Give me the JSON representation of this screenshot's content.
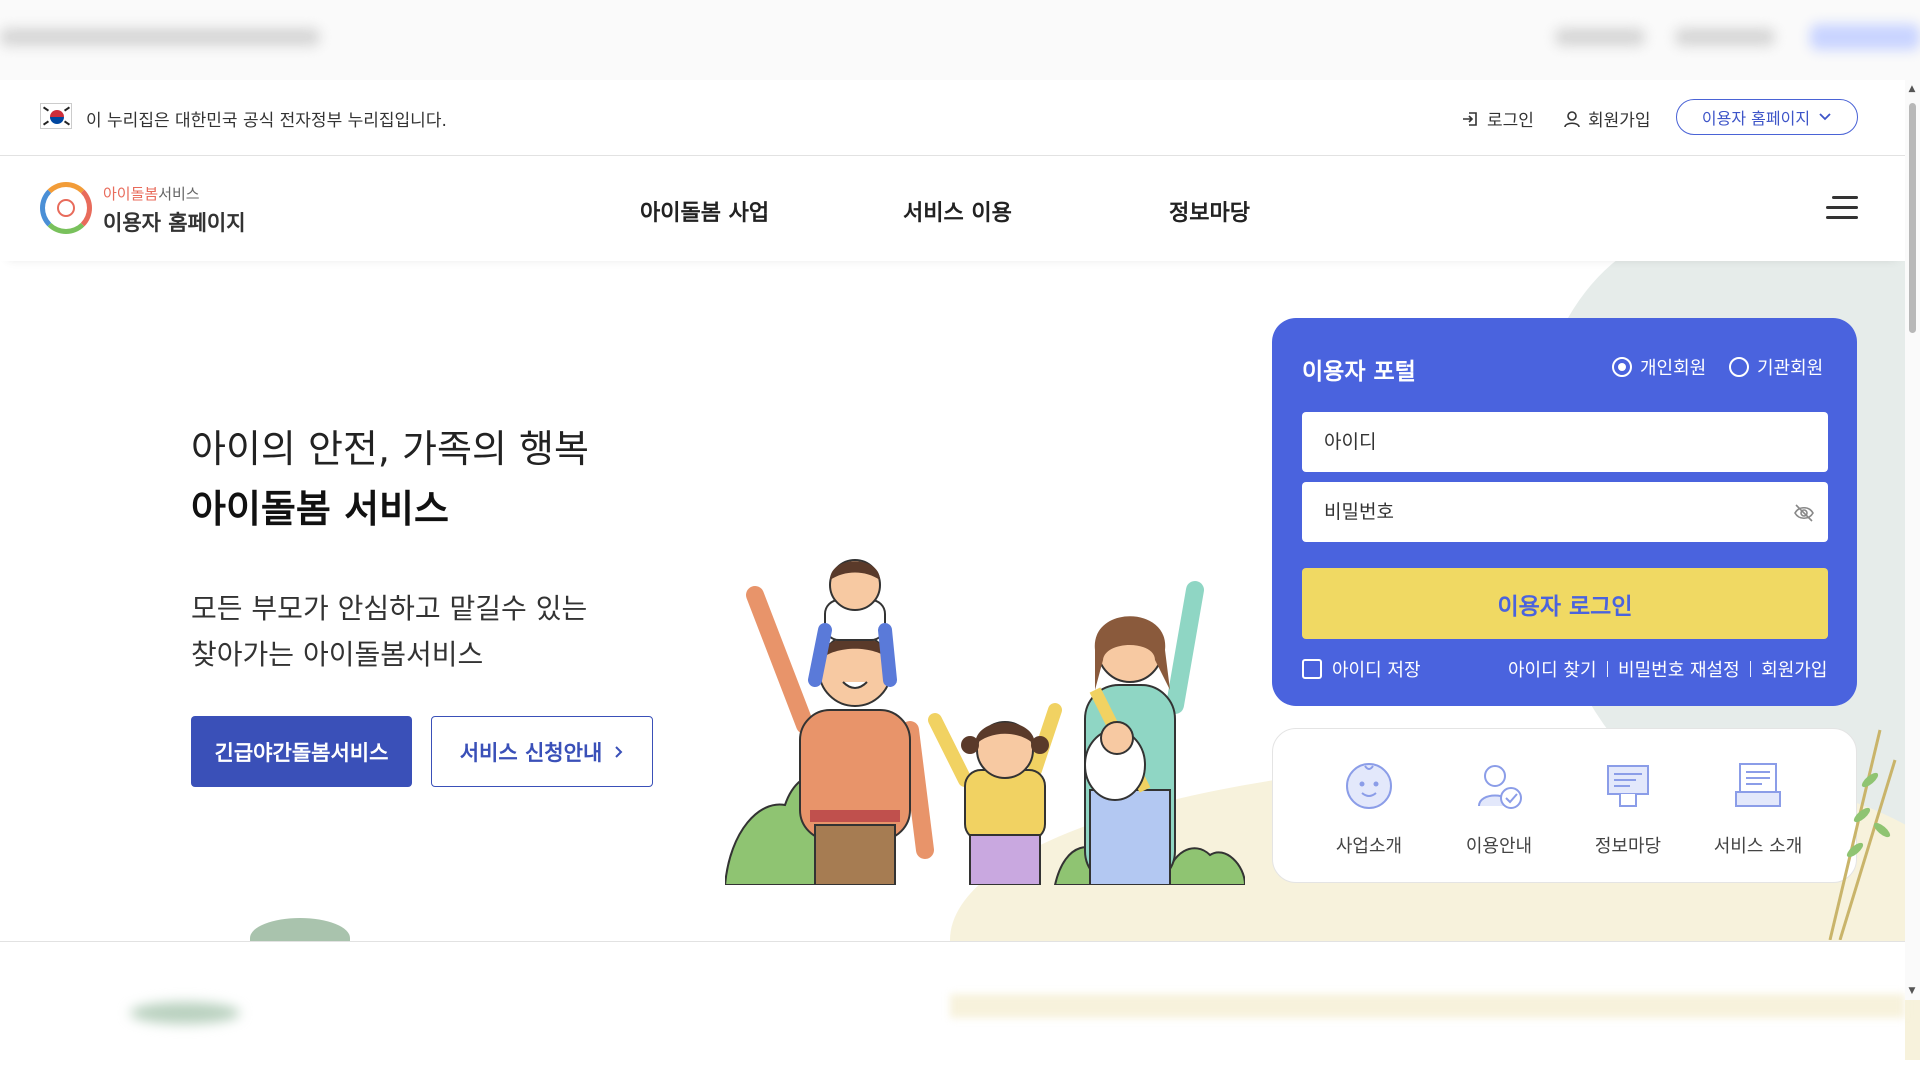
{
  "gov_bar": {
    "notice": "이 누리집은 대한민국 공식 전자정부 누리집입니다.",
    "login_label": "로그인",
    "signup_label": "회원가입",
    "home_select": "이용자 홈페이지"
  },
  "header": {
    "logo_accent": "아이돌봄",
    "logo_small_rest": "서비스",
    "logo_title": "이용자 홈페이지",
    "nav": [
      "아이돌봄 사업",
      "서비스 이용",
      "정보마당"
    ]
  },
  "hero": {
    "subtitle": "아이의 안전, 가족의 행복",
    "title": "아이돌봄 서비스",
    "desc_line1": "모든 부모가 안심하고 맡길수 있는",
    "desc_line2": "찾아가는 아이돌봄서비스",
    "primary_button": "긴급야간돌봄서비스",
    "outline_button": "서비스 신청안내"
  },
  "login": {
    "title": "이용자 포털",
    "radio_personal": "개인회원",
    "radio_org": "기관회원",
    "id_placeholder": "아이디",
    "pw_placeholder": "비밀번호",
    "submit": "이용자 로그인",
    "save_id": "아이디 저장",
    "find_id": "아이디 찾기",
    "reset_pw": "비밀번호 재설정",
    "signup": "회원가입"
  },
  "quick_menu": [
    {
      "label": "사업소개",
      "icon": "baby-face-icon"
    },
    {
      "label": "이용안내",
      "icon": "user-check-icon"
    },
    {
      "label": "정보마당",
      "icon": "document-icon"
    },
    {
      "label": "서비스 소개",
      "icon": "monitor-icon"
    }
  ],
  "colors": {
    "primary": "#3a50b8",
    "card_blue": "#4a63de",
    "login_button": "#f0d963"
  }
}
